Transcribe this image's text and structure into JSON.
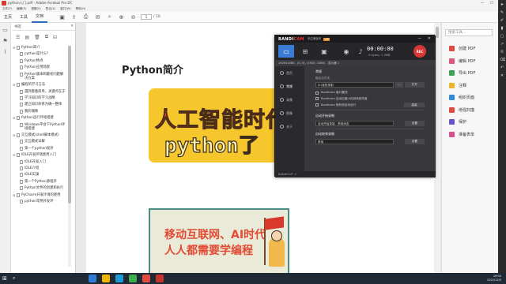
{
  "window": {
    "title": "python入门.pdf - Adobe Acrobat Pro DC",
    "controls": [
      "—",
      "☐",
      "✕"
    ]
  },
  "menubar": {
    "items": [
      "文件(F)",
      "编辑(E)",
      "视图(V)",
      "签名(S)",
      "窗口(W)",
      "帮助(H)"
    ]
  },
  "toolbar": {
    "tabs": [
      "主页",
      "工具",
      "文档"
    ],
    "page_current": "1",
    "page_total": "/ 10"
  },
  "bookmarks": {
    "header": "书签",
    "items": [
      {
        "level": 1,
        "exp": "⊟",
        "label": "Python简介"
      },
      {
        "level": 2,
        "exp": "",
        "label": "python是什么?"
      },
      {
        "level": 2,
        "exp": "",
        "label": "Python特点"
      },
      {
        "level": 2,
        "exp": "",
        "label": "Python应用场景"
      },
      {
        "level": 2,
        "exp": "",
        "label": "Python版本和最初问题解决方案"
      },
      {
        "level": 1,
        "exp": "⊟",
        "label": "编程的学习方法"
      },
      {
        "level": 2,
        "exp": "",
        "label": "遇到看着简单，关键点在于"
      },
      {
        "level": 2,
        "exp": "",
        "label": "学习知识的学习战略"
      },
      {
        "level": 2,
        "exp": "",
        "label": "建立知识体系为确一整体"
      },
      {
        "level": 2,
        "exp": "",
        "label": "我的偶像"
      },
      {
        "level": 1,
        "exp": "⊟",
        "label": "Python运行环境搭建"
      },
      {
        "level": 2,
        "exp": "",
        "label": "Windows平台下Python环境搭建"
      },
      {
        "level": 1,
        "exp": "⊟",
        "label": "交互模式(shell脚本模式)"
      },
      {
        "level": 2,
        "exp": "",
        "label": "交互模式详解"
      },
      {
        "level": 2,
        "exp": "",
        "label": "第一个python程序"
      },
      {
        "level": 1,
        "exp": "⊟",
        "label": "IDLE开发环境使用入门"
      },
      {
        "level": 2,
        "exp": "",
        "label": "IDLE开发入门"
      },
      {
        "level": 2,
        "exp": "",
        "label": "IDLE介绍"
      },
      {
        "level": 2,
        "exp": "",
        "label": "IDLE实操"
      },
      {
        "level": 2,
        "exp": "",
        "label": "第一个Python源程序"
      },
      {
        "level": 2,
        "exp": "",
        "label": "Python文件的创建和执行"
      },
      {
        "level": 1,
        "exp": "⊟",
        "label": "PyCharm开发环境的使用"
      },
      {
        "level": 2,
        "exp": "",
        "label": "python常用开发环"
      }
    ]
  },
  "document": {
    "heading": "Python简介",
    "banner1": {
      "line1": "人工智能时代",
      "line2": "python了"
    },
    "banner2": {
      "line1": "移动互联网、AI时代",
      "line2": "人人都需要学编程"
    }
  },
  "tools_panel": {
    "search_placeholder": "搜索工具...",
    "items": [
      {
        "label": "创建 PDF",
        "color": "#e04a3f"
      },
      {
        "label": "编辑 PDF",
        "color": "#e0557e"
      },
      {
        "label": "导出 PDF",
        "color": "#3aa55a"
      },
      {
        "label": "注释",
        "color": "#f0b429"
      },
      {
        "label": "组织页面",
        "color": "#2d8bd9"
      },
      {
        "label": "增强扫描",
        "color": "#e04a3f"
      },
      {
        "label": "保护",
        "color": "#6a53c9"
      },
      {
        "label": "准备表单",
        "color": "#d94e8f"
      }
    ]
  },
  "bandicam": {
    "logo_a": "BANDI",
    "logo_b": "CAM",
    "reg": "未注册版本",
    "vip": "VIP",
    "title_controls": "— ✕",
    "timer": "00:00:00",
    "size": "0 bytes / 1.3MB",
    "rec": "REC",
    "info": "1920x1080 - (0, 0), (1920, 1080) - 显示器 1",
    "nav": [
      "首页",
      "常规",
      "录像",
      "图像",
      "关于"
    ],
    "section": "常规",
    "folder_label": "输出文件夹",
    "folder_path": "D:\\我的录制",
    "folder_dots": "...",
    "folder_open": "打开",
    "checks": [
      "Bandicam 窗口置顶",
      "Bandicam 启动后最小化到系统托盘",
      "Bandicam 随系统启动运行"
    ],
    "advanced": "高级",
    "sect2": "自动开始录制",
    "sect2_field": "自动开始录制 - 禁用状态",
    "sect2_btn": "设置",
    "sect3": "自动结束录制",
    "sect3_field": "禁用",
    "sect3_btn": "设置",
    "footer": "BANDICUT ↗"
  },
  "taskbar": {
    "time": "16:04",
    "date": "2022/12/5",
    "apps": [
      "#2f7bd6",
      "#f1b400",
      "#1e9bd7",
      "#3cb04a",
      "#e04a3f",
      "#c7332d"
    ]
  }
}
